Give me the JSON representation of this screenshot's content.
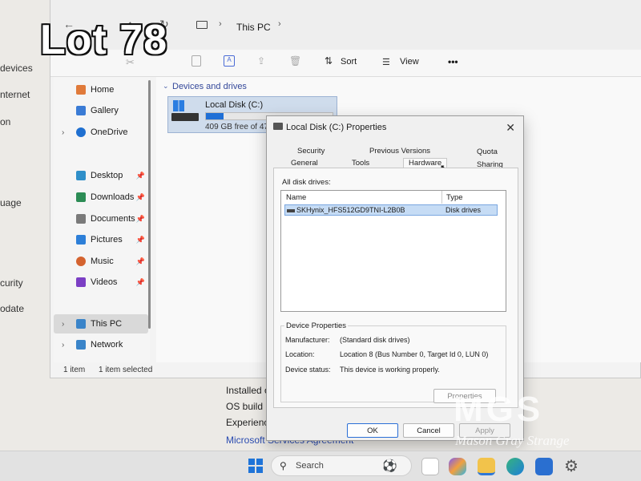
{
  "overlay": {
    "lot_label": "Lot 78",
    "watermark_logo": "MGS",
    "watermark_name": "Mason Gray Strange"
  },
  "background_settings": {
    "left_items": [
      "devices",
      "nternet",
      "on",
      "uage",
      "curity",
      "odate"
    ],
    "lower_items": [
      "Installed o",
      "OS build",
      "Experienc",
      "Microsoft Services Agreement"
    ]
  },
  "explorer": {
    "breadcrumb": "This PC",
    "toolbar": {
      "sort_label": "Sort",
      "view_label": "View",
      "more_label": "•••"
    },
    "nav_items": [
      {
        "label": "Home",
        "icon": "home-icon"
      },
      {
        "label": "Gallery",
        "icon": "gallery-icon"
      },
      {
        "label": "OneDrive",
        "icon": "cloud-icon"
      },
      {
        "label": "Desktop",
        "icon": "desktop-icon"
      },
      {
        "label": "Downloads",
        "icon": "download-icon"
      },
      {
        "label": "Documents",
        "icon": "documents-icon"
      },
      {
        "label": "Pictures",
        "icon": "pictures-icon"
      },
      {
        "label": "Music",
        "icon": "music-icon"
      },
      {
        "label": "Videos",
        "icon": "videos-icon"
      },
      {
        "label": "This PC",
        "icon": "pc-icon"
      },
      {
        "label": "Network",
        "icon": "network-icon"
      }
    ],
    "section_header": "Devices and drives",
    "drive": {
      "name": "Local Disk (C:)",
      "free_text": "409 GB free of 47",
      "used_fraction": 0.14
    },
    "status": {
      "count": "1 item",
      "selected": "1 item selected"
    }
  },
  "dialog": {
    "title": "Local Disk (C:) Properties",
    "tabs_row1": [
      "Security",
      "Previous Versions",
      "Quota"
    ],
    "tabs_row2": [
      "General",
      "Tools",
      "Hardware",
      "Sharing"
    ],
    "active_tab": "Hardware",
    "all_disks_label": "All disk drives:",
    "columns": {
      "name": "Name",
      "type": "Type"
    },
    "disk_rows": [
      {
        "name": "SKHynix_HFS512GD9TNI-L2B0B",
        "type": "Disk drives"
      }
    ],
    "device_properties": {
      "header": "Device Properties",
      "rows": [
        {
          "label": "Manufacturer:",
          "value": "(Standard disk drives)"
        },
        {
          "label": "Location:",
          "value": "Location 8 (Bus Number 0, Target Id 0, LUN 0)"
        },
        {
          "label": "Device status:",
          "value": "This device is working properly."
        }
      ],
      "properties_button": "Properties"
    },
    "buttons": {
      "ok": "OK",
      "cancel": "Cancel",
      "apply": "Apply"
    }
  },
  "taskbar": {
    "search_label": "Search"
  }
}
